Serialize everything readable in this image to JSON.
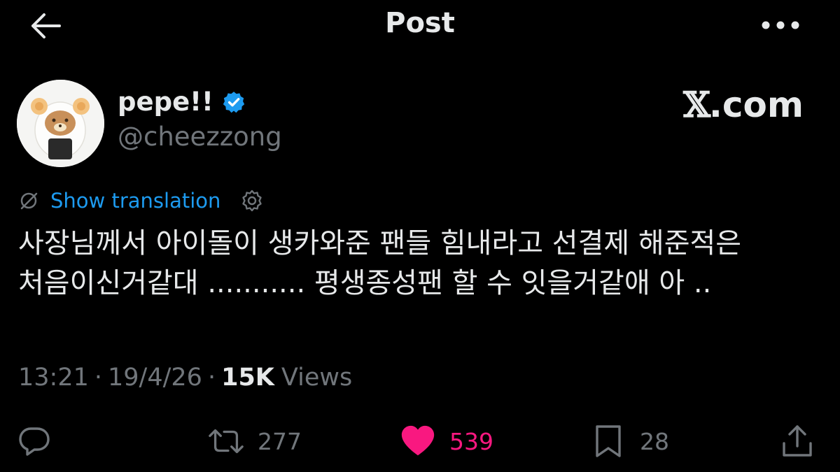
{
  "header": {
    "title": "Post"
  },
  "author": {
    "display_name": "pepe!!",
    "handle": "@cheezzong",
    "watermark": {
      "x_glyph": "𝕏",
      "suffix": ".com"
    }
  },
  "translation": {
    "label": "Show translation"
  },
  "tweet": {
    "lines": [
      "사장님께서 아이돌이 생카와준 팬들 힘내라고 선결제 해준적은",
      "처음이신거같대 ........... 평생종성팬 할 수 잇을거같애 아 .."
    ]
  },
  "meta": {
    "time": "13:21",
    "date": "19/4/26",
    "separator": "·",
    "views_count": "15K",
    "views_label": "Views"
  },
  "actions": {
    "reply": {
      "icon": "reply-icon",
      "count": ""
    },
    "repost": {
      "icon": "repost-icon",
      "count": "277"
    },
    "like": {
      "icon": "heart-icon",
      "count": "539",
      "color": "#f91880"
    },
    "bookmark": {
      "icon": "bookmark-icon",
      "count": "28"
    },
    "share": {
      "icon": "share-icon"
    }
  },
  "colors": {
    "background": "#000000",
    "text": "#e7e9ea",
    "muted": "#71767b",
    "link": "#1d9bf0",
    "verified": "#1d9bf0",
    "like": "#f91880"
  }
}
